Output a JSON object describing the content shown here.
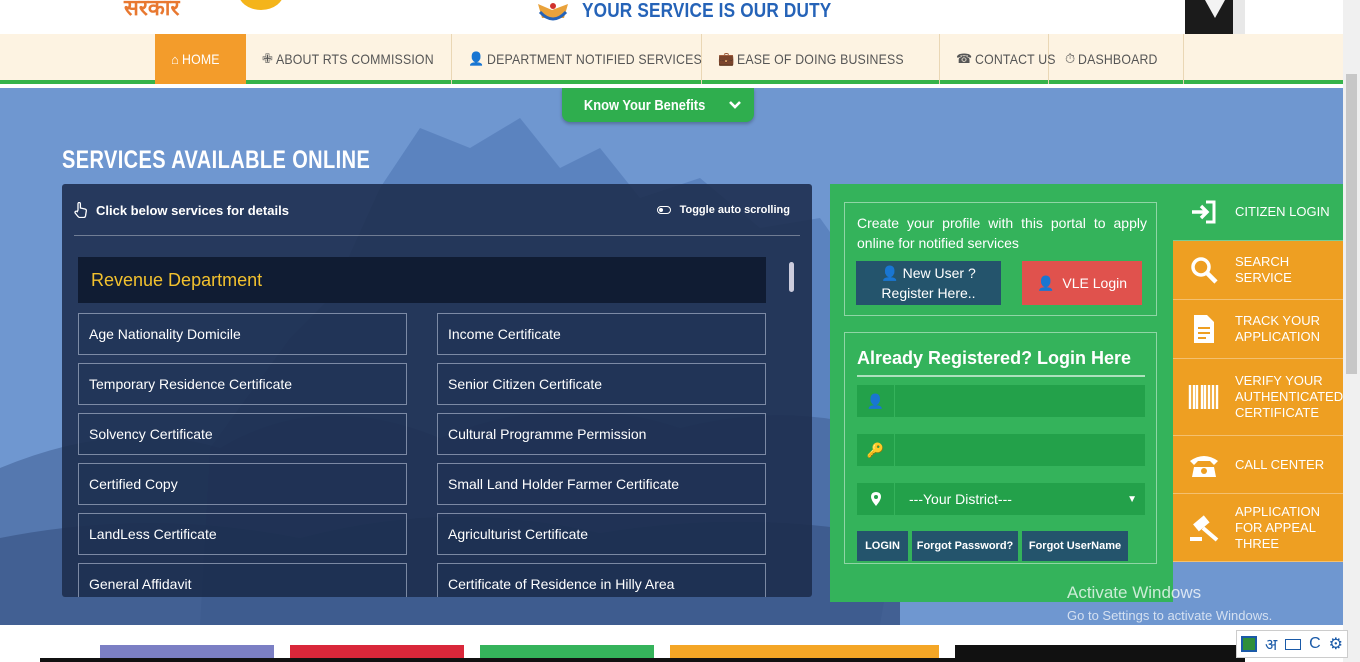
{
  "header": {
    "logo_text": "सरकार",
    "tagline": "YOUR SERVICE IS OUR DUTY"
  },
  "nav": {
    "items": [
      {
        "label": "HOME",
        "icon": "home-icon",
        "active": true
      },
      {
        "label": "ABOUT RTS COMMISSION",
        "icon": "person-icon"
      },
      {
        "label": "DEPARTMENT NOTIFIED SERVICES",
        "icon": "user-icon"
      },
      {
        "label": "EASE OF DOING BUSINESS",
        "icon": "briefcase-icon"
      },
      {
        "label": "CONTACT US",
        "icon": "phone-icon"
      },
      {
        "label": "DASHBOARD",
        "icon": "dashboard-icon"
      }
    ]
  },
  "banner": {
    "know_label": "Know Your Benefits"
  },
  "services": {
    "title": "SERVICES AVAILABLE ONLINE",
    "click_note": "Click below services for details",
    "toggle_label": "Toggle auto scrolling",
    "department": "Revenue Department",
    "items": [
      "Age Nationality Domicile",
      "Income Certificate",
      "Temporary Residence Certificate",
      "Senior Citizen Certificate",
      "Solvency Certificate",
      "Cultural Programme Permission",
      "Certified Copy",
      "Small Land Holder Farmer Certificate",
      "LandLess Certificate",
      "Agriculturist Certificate",
      "General Affidavit",
      "Certificate of Residence in Hilly Area"
    ]
  },
  "login": {
    "intro": "Create your profile with this portal to apply online for notified services",
    "new_user_line1": "New User ?",
    "new_user_line2": "Register Here..",
    "vle_label": "VLE Login",
    "title": "Already Registered? Login Here",
    "username_value": "",
    "password_value": "",
    "district_selected": "---Your District---",
    "login_btn": "LOGIN",
    "forgot_password_btn": "Forgot Password?",
    "forgot_username_btn": "Forgot UserName"
  },
  "side_menu": [
    {
      "label": "CITIZEN LOGIN",
      "icon": "sign-in-icon",
      "color": "#34b35b"
    },
    {
      "label": "SEARCH SERVICE",
      "icon": "search-icon",
      "color": "#ee9f22"
    },
    {
      "label": "TRACK YOUR APPLICATION",
      "icon": "document-icon",
      "color": "#ee9f22"
    },
    {
      "label": "VERIFY YOUR AUTHENTICATED CERTIFICATE",
      "icon": "barcode-icon",
      "color": "#ee9f22"
    },
    {
      "label": "CALL CENTER",
      "icon": "telephone-icon",
      "color": "#ee9f22"
    },
    {
      "label": "APPLICATION FOR APPEAL THREE",
      "icon": "gavel-icon",
      "color": "#ee9f22"
    }
  ],
  "watermark": {
    "line1": "Activate Windows",
    "line2": "Go to Settings to activate Windows."
  },
  "tray": {
    "language": "अ",
    "keyboard_letter": "C"
  },
  "colors": {
    "accent_orange": "#f39c2b",
    "green": "#34b35b",
    "navy_button": "#24546c",
    "red_button": "#e0524d",
    "dept_text": "#f2c12e"
  }
}
